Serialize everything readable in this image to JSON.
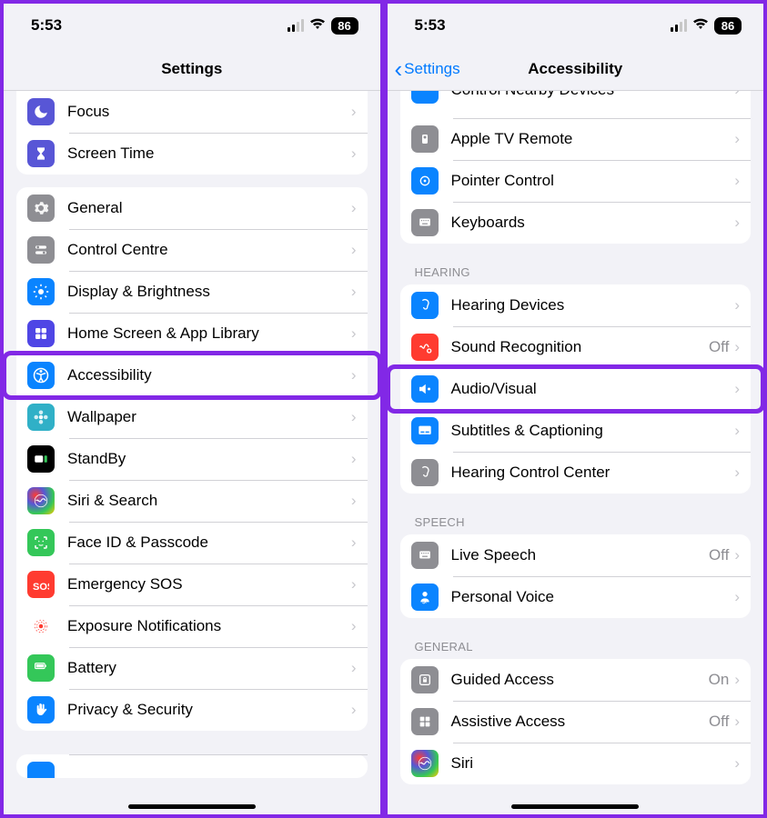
{
  "left": {
    "time": "5:53",
    "battery": "86",
    "title": "Settings",
    "groups": [
      {
        "rows": [
          {
            "name": "focus",
            "label": "Focus",
            "icon_bg": "#5856d6",
            "svg": "moon"
          },
          {
            "name": "screen-time",
            "label": "Screen Time",
            "icon_bg": "#5856d6",
            "svg": "hourglass"
          }
        ]
      },
      {
        "rows": [
          {
            "name": "general",
            "label": "General",
            "icon_bg": "#8e8e93",
            "svg": "gear"
          },
          {
            "name": "control-centre",
            "label": "Control Centre",
            "icon_bg": "#8e8e93",
            "svg": "toggles"
          },
          {
            "name": "display-brightness",
            "label": "Display & Brightness",
            "icon_bg": "#0a84ff",
            "svg": "sun"
          },
          {
            "name": "home-screen",
            "label": "Home Screen & App Library",
            "icon_bg": "#4f46e5",
            "svg": "grid"
          },
          {
            "name": "accessibility",
            "label": "Accessibility",
            "icon_bg": "#0a84ff",
            "svg": "accessibility",
            "highlight": true
          },
          {
            "name": "wallpaper",
            "label": "Wallpaper",
            "icon_bg": "#30b0c7",
            "svg": "flower"
          },
          {
            "name": "standby",
            "label": "StandBy",
            "icon_bg": "#000000",
            "svg": "standby"
          },
          {
            "name": "siri-search",
            "label": "Siri & Search",
            "icon_bg": "grad",
            "svg": "siri"
          },
          {
            "name": "face-id",
            "label": "Face ID & Passcode",
            "icon_bg": "#34c759",
            "svg": "faceid"
          },
          {
            "name": "emergency-sos",
            "label": "Emergency SOS",
            "icon_bg": "#ff3b30",
            "svg": "sos"
          },
          {
            "name": "exposure",
            "label": "Exposure Notifications",
            "icon_bg": "#ffffff",
            "svg": "exposure",
            "icon_fg": "#ff3b30"
          },
          {
            "name": "battery",
            "label": "Battery",
            "icon_bg": "#34c759",
            "svg": "battery"
          },
          {
            "name": "privacy-security",
            "label": "Privacy & Security",
            "icon_bg": "#0a84ff",
            "svg": "hand"
          }
        ]
      },
      {
        "cut": true
      }
    ]
  },
  "right": {
    "time": "5:53",
    "battery": "86",
    "back": "Settings",
    "title": "Accessibility",
    "top_cut_label": "Control Nearby Devices",
    "top_rows": [
      {
        "name": "apple-tv-remote",
        "label": "Apple TV Remote",
        "icon_bg": "#8e8e93",
        "svg": "remote"
      },
      {
        "name": "pointer-control",
        "label": "Pointer Control",
        "icon_bg": "#0a84ff",
        "svg": "pointer"
      },
      {
        "name": "keyboards",
        "label": "Keyboards",
        "icon_bg": "#8e8e93",
        "svg": "keyboard"
      }
    ],
    "sections": [
      {
        "header": "HEARING",
        "rows": [
          {
            "name": "hearing-devices",
            "label": "Hearing Devices",
            "icon_bg": "#0a84ff",
            "svg": "ear"
          },
          {
            "name": "sound-recognition",
            "label": "Sound Recognition",
            "icon_bg": "#ff3b30",
            "svg": "sound",
            "detail": "Off"
          },
          {
            "name": "audio-visual",
            "label": "Audio/Visual",
            "icon_bg": "#0a84ff",
            "svg": "speaker",
            "highlight": true
          },
          {
            "name": "subtitles",
            "label": "Subtitles & Captioning",
            "icon_bg": "#0a84ff",
            "svg": "subtitles"
          },
          {
            "name": "hearing-control",
            "label": "Hearing Control Center",
            "icon_bg": "#8e8e93",
            "svg": "ear2"
          }
        ]
      },
      {
        "header": "SPEECH",
        "rows": [
          {
            "name": "live-speech",
            "label": "Live Speech",
            "icon_bg": "#8e8e93",
            "svg": "keyboard",
            "detail": "Off"
          },
          {
            "name": "personal-voice",
            "label": "Personal Voice",
            "icon_bg": "#0a84ff",
            "svg": "voice"
          }
        ]
      },
      {
        "header": "GENERAL",
        "rows": [
          {
            "name": "guided-access",
            "label": "Guided Access",
            "icon_bg": "#8e8e93",
            "svg": "lock",
            "detail": "On"
          },
          {
            "name": "assistive-access",
            "label": "Assistive Access",
            "icon_bg": "#8e8e93",
            "svg": "grid2",
            "detail": "Off"
          },
          {
            "name": "siri",
            "label": "Siri",
            "icon_bg": "grad",
            "svg": "siri"
          }
        ]
      }
    ]
  }
}
